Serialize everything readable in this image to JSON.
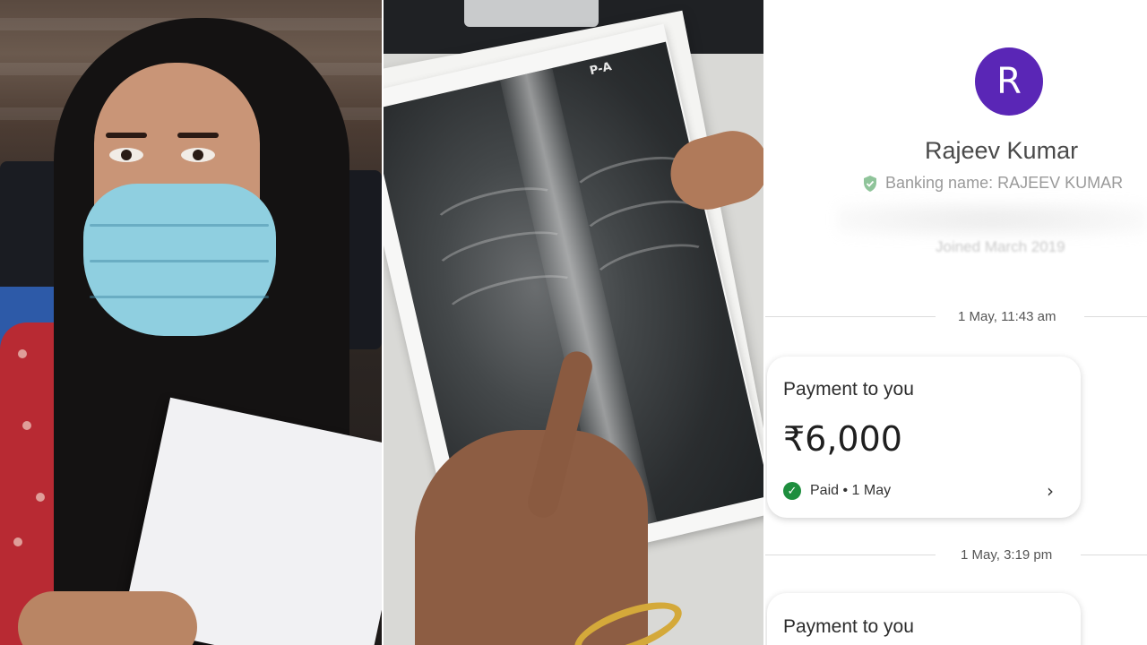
{
  "xray": {
    "marker": "P-A"
  },
  "payment_app": {
    "contact": {
      "avatar_letter": "R",
      "name": "Rajeev Kumar",
      "banking_name": "Banking name: RAJEEV KUMAR",
      "joined": "Joined March 2019"
    },
    "timestamps": [
      "1 May, 11:43 am",
      "1 May, 3:19 pm"
    ],
    "transactions": [
      {
        "title": "Payment to you",
        "amount": "₹6,000",
        "status": "Paid • 1 May"
      },
      {
        "title": "Payment to you"
      }
    ],
    "colors": {
      "avatar": "#5a26b6",
      "paid_check": "#1e8e3e",
      "verified_shield": "#8fc49a"
    }
  }
}
